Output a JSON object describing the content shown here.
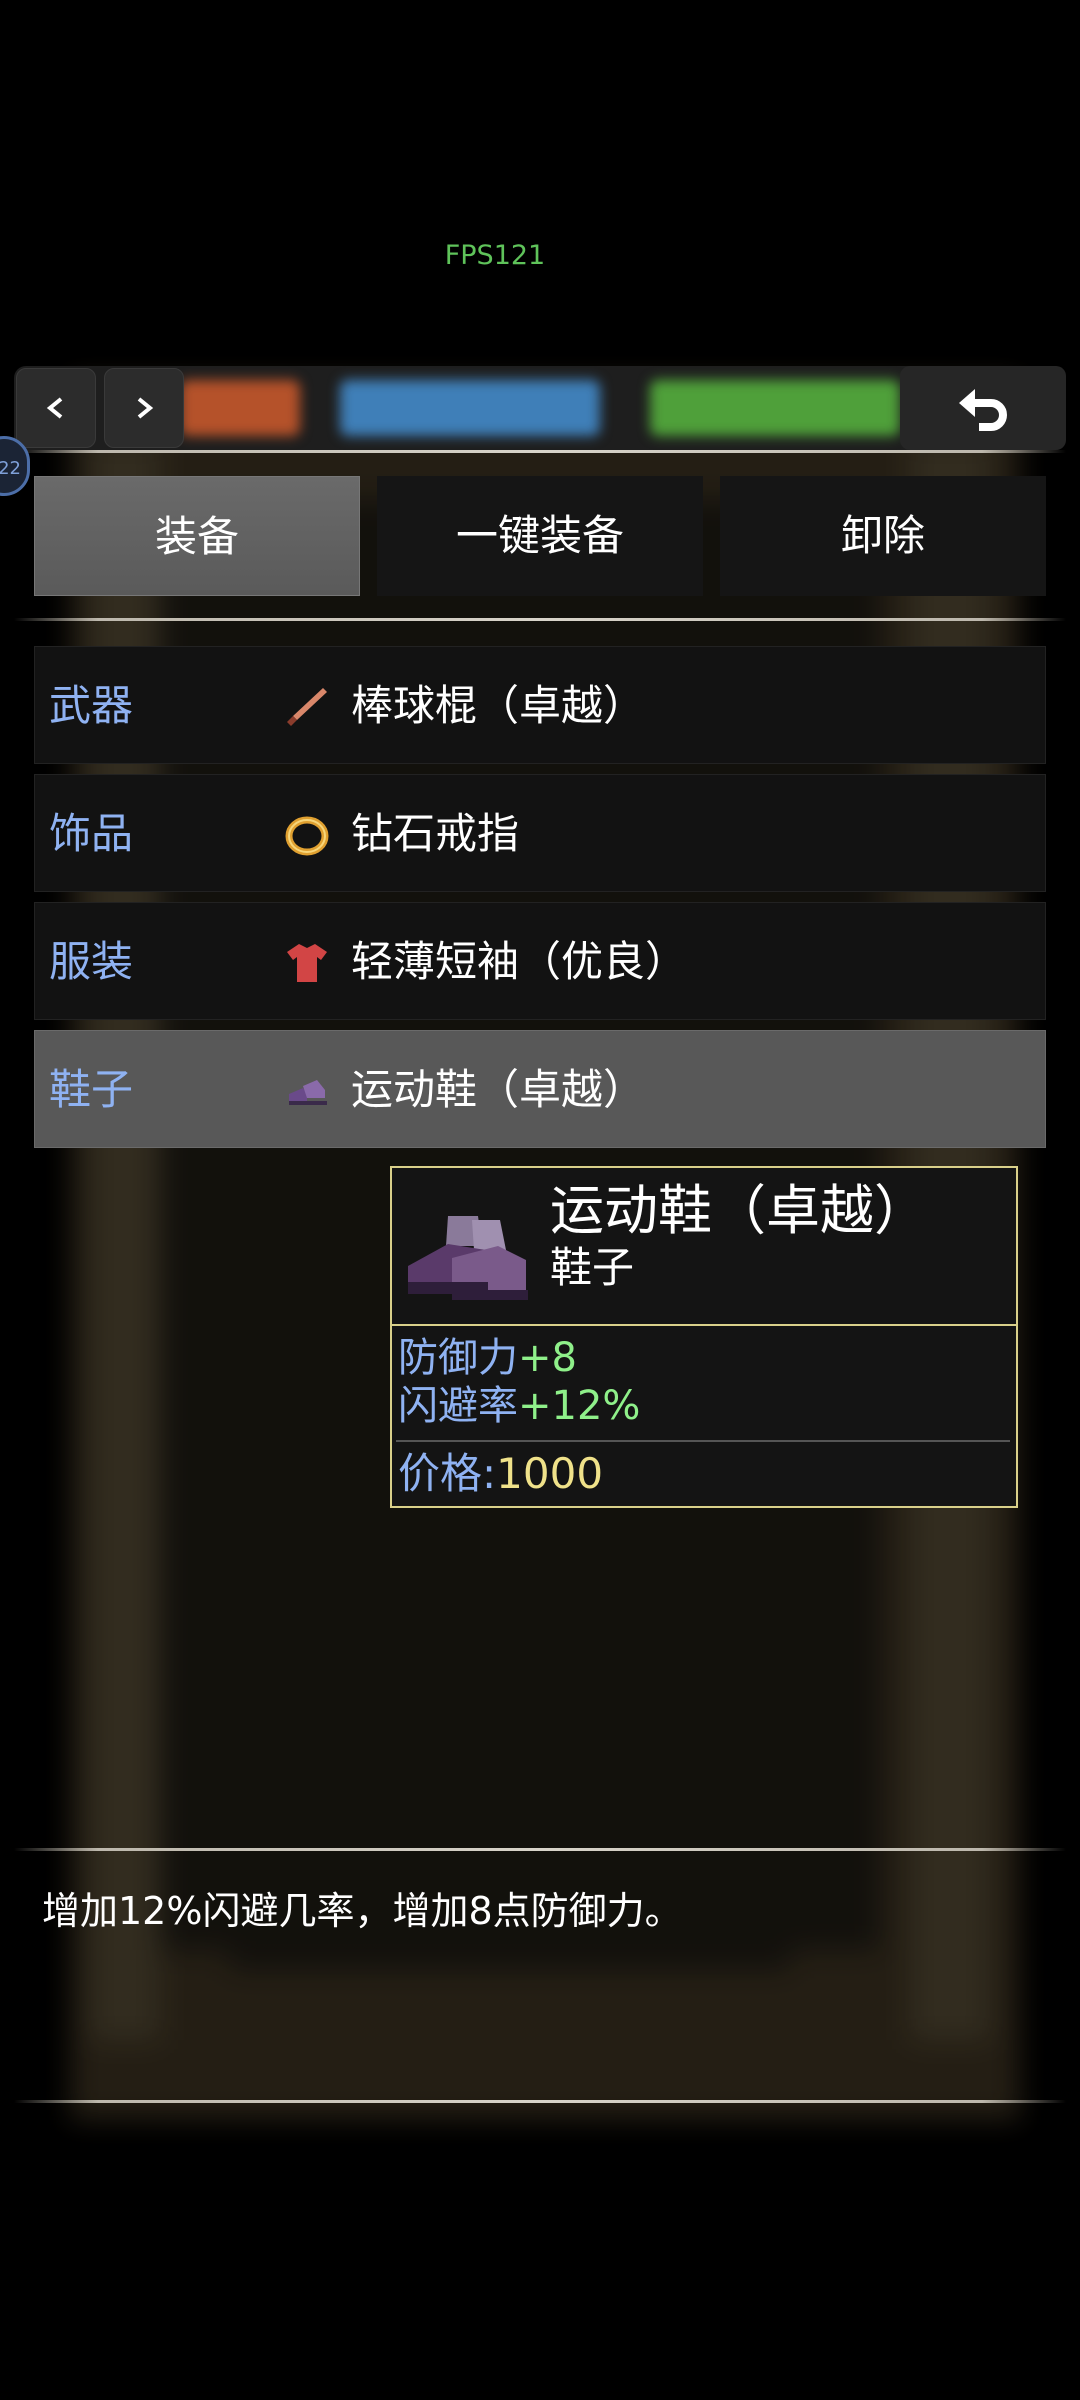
{
  "fps": "FPS121",
  "badge": "22",
  "tabs": [
    "装备",
    "一键装备",
    "卸除"
  ],
  "slots": [
    {
      "slot": "武器",
      "item": "棒球棍（卓越）",
      "icon": "baseball-bat-icon"
    },
    {
      "slot": "饰品",
      "item": "钻石戒指",
      "icon": "diamond-ring-icon"
    },
    {
      "slot": "服装",
      "item": "轻薄短袖（优良）",
      "icon": "t-shirt-icon"
    },
    {
      "slot": "鞋子",
      "item": "运动鞋（卓越）",
      "icon": "sneakers-icon"
    }
  ],
  "tooltip": {
    "name": "运动鞋（卓越）",
    "type": "鞋子",
    "stat1_label": "防御力",
    "stat1_value": "+8",
    "stat2_label": "闪避率",
    "stat2_value": "+12%",
    "price_label": "价格:",
    "price_value": "1000"
  },
  "description": "增加12%闪避几率，增加8点防御力。",
  "colors": {
    "slot_label": "#8fb2f2",
    "stat_value": "#8ff08a",
    "price_value": "#f0e28a",
    "tooltip_border": "#d9d08a",
    "fps": "#5fc35a"
  }
}
